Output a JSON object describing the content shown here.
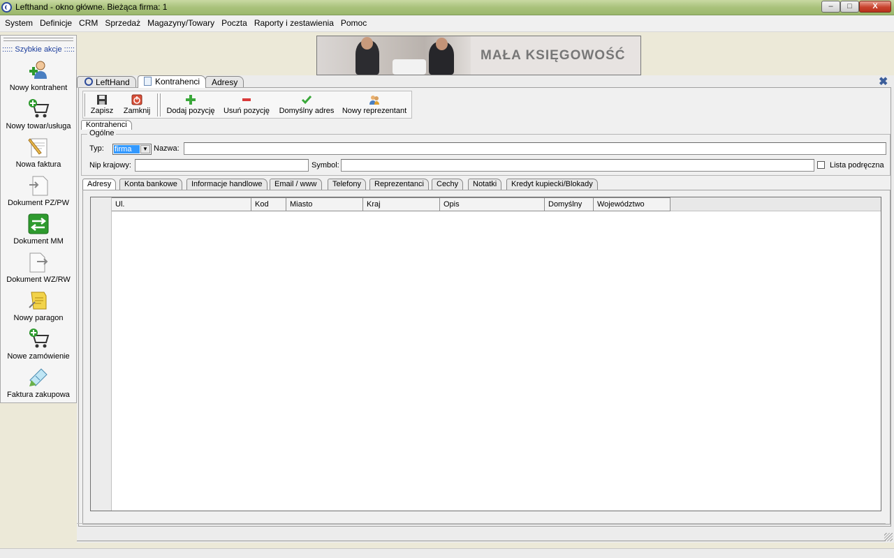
{
  "window": {
    "title": "Lefthand - okno główne. Bieżąca firma: 1",
    "minimize": "–",
    "maximize": "□",
    "close": "X"
  },
  "menu": [
    "System",
    "Definicje",
    "CRM",
    "Sprzedaż",
    "Magazyny/Towary",
    "Poczta",
    "Raporty i zestawienia",
    "Pomoc"
  ],
  "sidebar": {
    "title": "::::: Szybkie akcje :::::",
    "items": [
      {
        "label": "Nowy kontrahent",
        "icon": "user-add-icon"
      },
      {
        "label": "Nowy towar/usługa",
        "icon": "cart-add-icon"
      },
      {
        "label": "Nowa faktura",
        "icon": "invoice-pencil-icon"
      },
      {
        "label": "Dokument PZ/PW",
        "icon": "document-in-icon"
      },
      {
        "label": "Dokument MM",
        "icon": "transfer-arrows-icon"
      },
      {
        "label": "Dokument WZ/RW",
        "icon": "document-out-icon"
      },
      {
        "label": "Nowy paragon",
        "icon": "receipt-icon"
      },
      {
        "label": "Nowe zamówienie",
        "icon": "cart-order-icon"
      },
      {
        "label": "Faktura zakupowa",
        "icon": "purchase-invoice-icon"
      }
    ]
  },
  "banner": {
    "text": "MAŁA KSIĘGOWOŚĆ"
  },
  "tabs": [
    {
      "label": "LeftHand",
      "icon": "lefthand-logo-icon"
    },
    {
      "label": "Kontrahenci",
      "icon": "document-icon"
    },
    {
      "label": "Adresy"
    }
  ],
  "panel_close": "✖",
  "toolbar": {
    "save": "Zapisz",
    "close": "Zamknij",
    "add_item": "Dodaj pozycję",
    "remove_item": "Usuń pozycję",
    "default_address": "Domyślny adres",
    "new_representative": "Nowy reprezentant"
  },
  "form_tab": "Kontrahenci",
  "form": {
    "group_title": "Ogólne",
    "typ_label": "Typ:",
    "typ_value": "firma",
    "nazwa_label": "Nazwa:",
    "nazwa_value": "",
    "nip_label": "Nip krajowy:",
    "nip_value": "",
    "symbol_label": "Symbol:",
    "symbol_value": "",
    "lista_label": "Lista podręczna",
    "lista_checked": false
  },
  "subtabs": [
    "Adresy",
    "Konta bankowe",
    "Informacje handlowe",
    "Email / www",
    "Telefony",
    "Reprezentanci",
    "Cechy",
    "Notatki",
    "Kredyt kupiecki/Blokady"
  ],
  "grid": {
    "columns": [
      "Ul.",
      "Kod",
      "Miasto",
      "Kraj",
      "Opis",
      "Domyślny",
      "Województwo"
    ],
    "rows": []
  }
}
